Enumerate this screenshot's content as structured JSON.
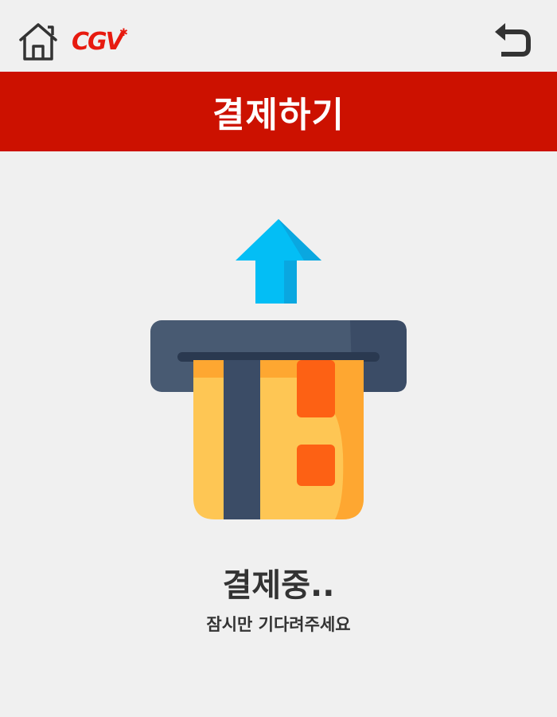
{
  "topbar": {
    "home_icon": "home-icon",
    "logo_text": "CGV",
    "back_icon": "back-arrow-icon"
  },
  "header": {
    "title": "결제하기"
  },
  "illustration": {
    "icon": "card-payment-icon"
  },
  "status": {
    "title": "결제중..",
    "subtitle": "잠시만 기다려주세요"
  },
  "colors": {
    "brand_red": "#cc1100",
    "logo_red": "#e71a0f",
    "arrow_blue": "#03bef5",
    "card_yellow": "#fec654",
    "card_orange": "#fd6114",
    "terminal_dark": "#485a72"
  }
}
